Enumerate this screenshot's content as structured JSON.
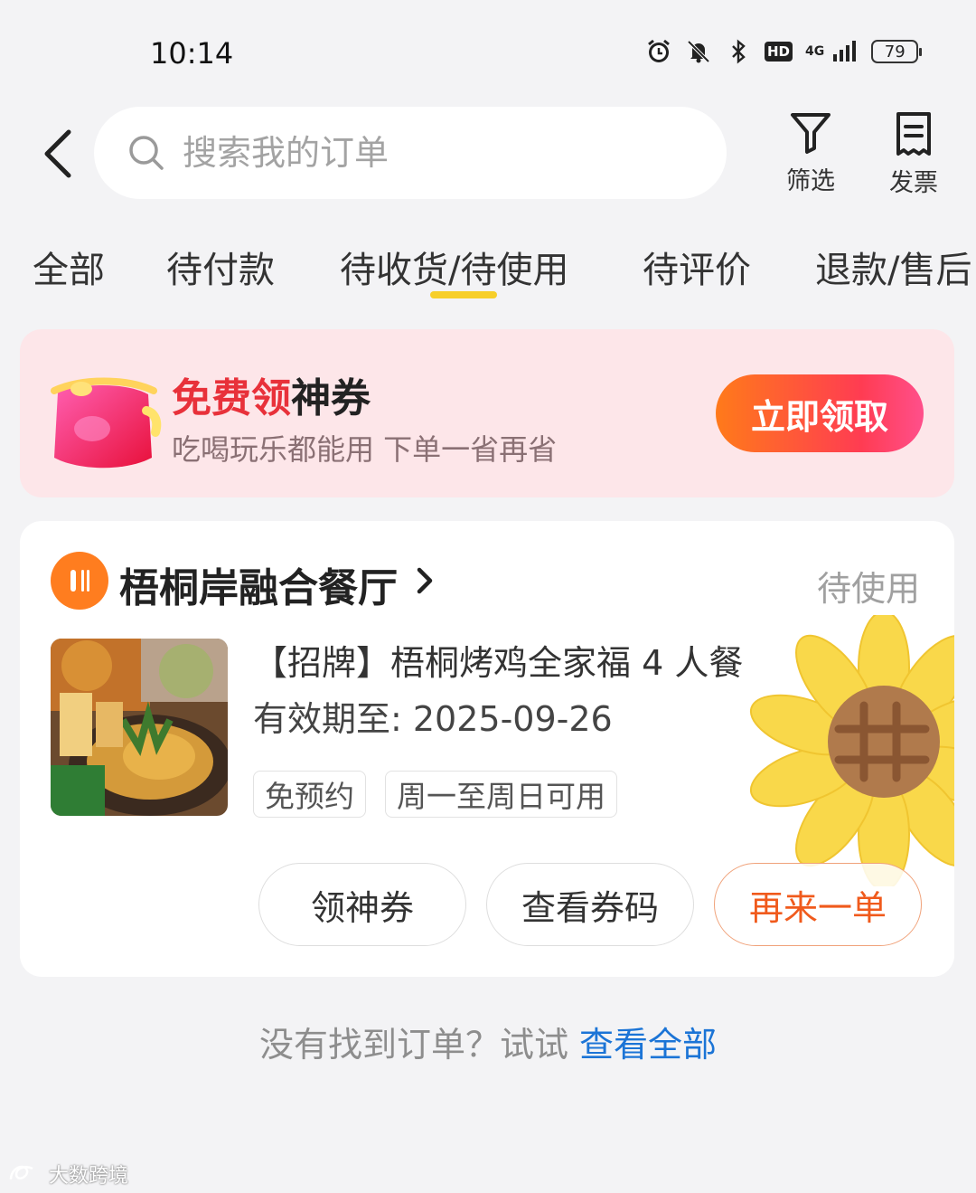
{
  "status_bar": {
    "time": "10:14",
    "hd": "HD",
    "network": "4G",
    "battery": "79"
  },
  "header": {
    "search_placeholder": "搜索我的订单",
    "filter_label": "筛选",
    "invoice_label": "发票"
  },
  "tabs": [
    {
      "label": "全部",
      "active": false
    },
    {
      "label": "待付款",
      "active": false
    },
    {
      "label": "待收货/待使用",
      "active": true
    },
    {
      "label": "待评价",
      "active": false
    },
    {
      "label": "退款/售后",
      "active": false
    }
  ],
  "promo": {
    "title_highlight": "免费领",
    "title_rest": "神券",
    "subtitle": "吃喝玩乐都能用 下单一省再省",
    "cta": "立即领取"
  },
  "order": {
    "store_name": "梧桐岸融合餐厅",
    "status": "待使用",
    "product_title": "【招牌】梧桐烤鸡全家福 4 人餐",
    "validity": "有效期至: 2025-09-26",
    "tags": [
      "免预约",
      "周一至周日可用"
    ],
    "actions": {
      "coupon": "领神券",
      "view_code": "查看券码",
      "reorder": "再来一单"
    }
  },
  "footer": {
    "text": "没有找到订单？试试 ",
    "link": "查看全部"
  },
  "watermark": "大数跨境",
  "colors": {
    "accent_yellow": "#f7cf2a",
    "promo_red": "#e8313a",
    "link_blue": "#1b74d6",
    "reorder_orange": "#f05a1c"
  }
}
